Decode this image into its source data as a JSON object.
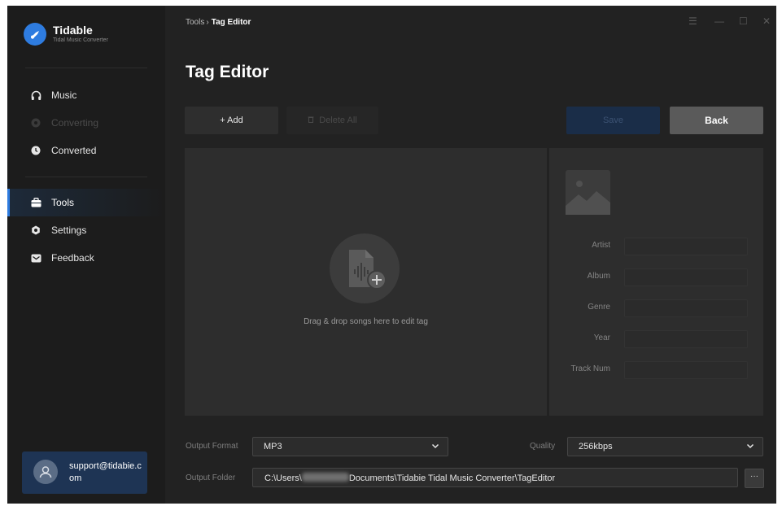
{
  "app": {
    "name": "Tidable",
    "subtitle": "Tidal Music Converter",
    "logo_icon": "music-note-icon",
    "accent_color": "#2e7ce0"
  },
  "sidebar": {
    "items": [
      {
        "label": "Music",
        "icon": "headphones-icon",
        "state": "normal"
      },
      {
        "label": "Converting",
        "icon": "converting-icon",
        "state": "disabled"
      },
      {
        "label": "Converted",
        "icon": "clock-icon",
        "state": "normal"
      },
      {
        "label": "Tools",
        "icon": "toolbox-icon",
        "state": "active"
      },
      {
        "label": "Settings",
        "icon": "gear-icon",
        "state": "normal"
      },
      {
        "label": "Feedback",
        "icon": "mail-icon",
        "state": "normal"
      }
    ],
    "user": {
      "email": "support@tidabie.com",
      "icon": "user-icon"
    }
  },
  "header": {
    "breadcrumb": {
      "parent": "Tools",
      "separator": "›",
      "current": "Tag Editor"
    },
    "window_controls": {
      "menu": "☰",
      "minimize": "—",
      "maximize": "☐",
      "close": "✕"
    }
  },
  "main": {
    "title": "Tag Editor",
    "toolbar": {
      "add_label": "+ Add",
      "delete_all_label": "Delete All",
      "save_label": "Save",
      "back_label": "Back"
    },
    "drop_area": {
      "text": "Drag & drop songs here to edit tag",
      "icon": "add-audio-file-icon"
    },
    "tag_fields": [
      {
        "label": "Artist",
        "value": ""
      },
      {
        "label": "Album",
        "value": ""
      },
      {
        "label": "Genre",
        "value": ""
      },
      {
        "label": "Year",
        "value": ""
      },
      {
        "label": "Track Num",
        "value": ""
      }
    ],
    "cover_icon": "image-placeholder-icon"
  },
  "output": {
    "format_label": "Output Format",
    "format_value": "MP3",
    "quality_label": "Quality",
    "quality_value": "256kbps",
    "folder_label": "Output Folder",
    "folder_path_prefix": "C:\\Users\\",
    "folder_path_suffix": "Documents\\Tidabie Tidal Music Converter\\TagEditor",
    "browse_label": "···"
  }
}
